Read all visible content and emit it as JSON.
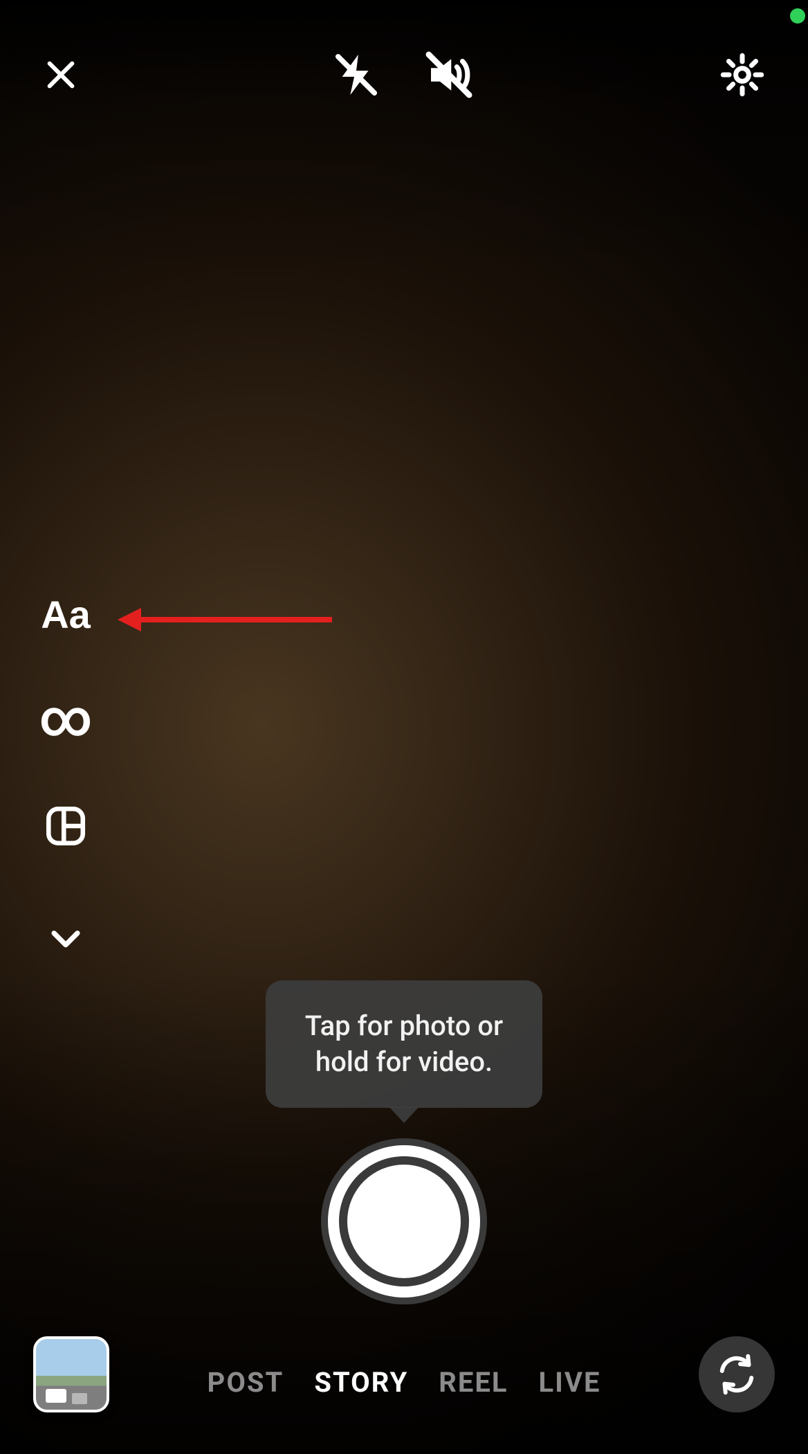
{
  "top": {
    "close_icon": "close",
    "flash_icon": "flash-off",
    "sound_icon": "sound-off",
    "settings_icon": "settings"
  },
  "side_tools": {
    "text": "Aa",
    "boomerang": "∞",
    "layout_icon": "layout",
    "expand_icon": "chevron-down"
  },
  "annotation": {
    "arrow_target": "text-tool"
  },
  "tooltip": {
    "text": "Tap for photo or hold for video."
  },
  "shutter": {
    "label": "capture"
  },
  "bottom": {
    "gallery_icon": "gallery",
    "switch_camera_icon": "switch-camera",
    "modes": [
      {
        "label": "POST",
        "active": false
      },
      {
        "label": "STORY",
        "active": true
      },
      {
        "label": "REEL",
        "active": false
      },
      {
        "label": "LIVE",
        "active": false
      }
    ]
  },
  "status": {
    "camera_active": true
  }
}
